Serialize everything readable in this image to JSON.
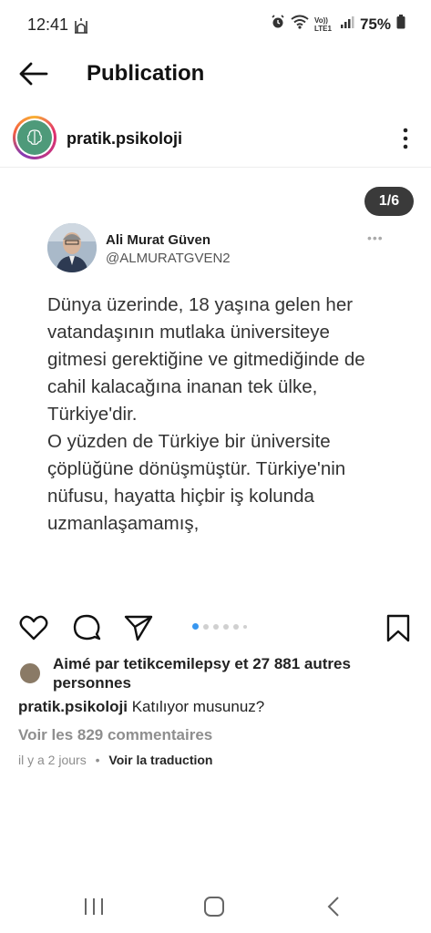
{
  "status_bar": {
    "time": "12:41",
    "battery": "75%",
    "net_label": "Vo)) LTE1"
  },
  "header": {
    "title": "Publication"
  },
  "post": {
    "author": "pratik.psikoloji",
    "page_counter": "1/6",
    "carousel_total_dots": 6,
    "carousel_active_index": 0
  },
  "tweet": {
    "name": "Ali Murat Güven",
    "handle": "@ALMURATGVEN2",
    "more": "•••",
    "text": "Dünya üzerinde, 18 yaşına gelen her\nvatandaşının mutlaka üniversiteye\ngitmesi gerektiğine ve gitmediğinde de\ncahil kalacağına inanan tek ülke,\nTürkiye'dir.\nO yüzden de Türkiye bir üniversite\nçöplüğüne dönüşmüştür. Türkiye'nin\nnüfusu, hayatta hiçbir iş kolunda\nuzmanlaşamamış,"
  },
  "engagement": {
    "likes_text": "Aimé par tetikcemilepsy et 27 881 autres personnes",
    "caption_user": "pratik.psikoloji",
    "caption_text": "Katılıyor musunuz?",
    "comments_link": "Voir les 829 commentaires",
    "timestamp": "il y a 2 jours",
    "separator": "•",
    "translate": "Voir la traduction"
  },
  "colors": {
    "accent_blue": "#3897f0",
    "counter_bg": "#3a3a3a",
    "muted": "#8e8e8e"
  }
}
